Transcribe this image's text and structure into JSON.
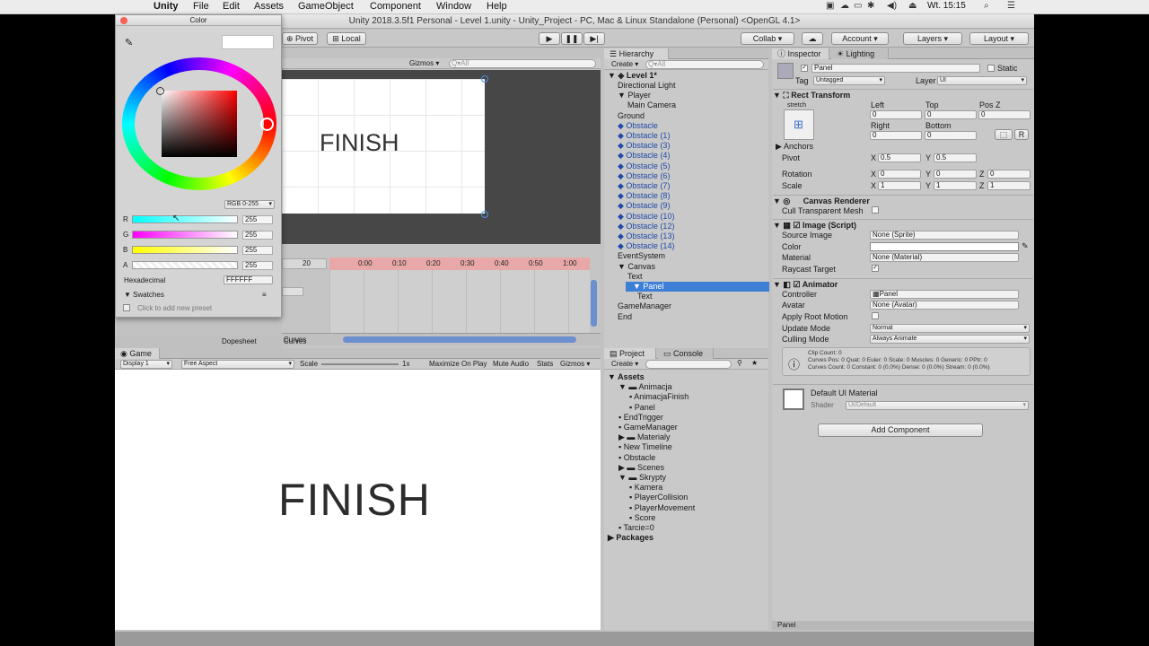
{
  "menubar": {
    "app": "Unity",
    "items": [
      "File",
      "Edit",
      "Assets",
      "GameObject",
      "Component",
      "Window",
      "Help"
    ],
    "clock": "Wt. 15:15"
  },
  "window": {
    "title": "Unity 2018.3.5f1 Personal - Level 1.unity - Unity_Project - PC, Mac & Linux Standalone (Personal) <OpenGL 4.1>"
  },
  "toolbar": {
    "pivot": "Pivot",
    "local": "Local",
    "collab": "Collab ▾",
    "account": "Account",
    "layers": "Layers",
    "layout": "Layout"
  },
  "scene": {
    "gizmos": "Gizmos",
    "search": "Q▾All",
    "text": "FINISH"
  },
  "animation": {
    "frame": "20",
    "ticks": [
      "0:00",
      "0:10",
      "0:20",
      "0:30",
      "0:40",
      "0:50",
      "1:00"
    ],
    "tab_dopesheet": "Dopesheet",
    "tab_curves": "Curves"
  },
  "game": {
    "tab": "Game",
    "display": "Display 1",
    "aspect": "Free Aspect",
    "scale_label": "Scale",
    "scale_value": "1x",
    "maximize": "Maximize On Play",
    "mute": "Mute Audio",
    "stats": "Stats",
    "gizmos": "Gizmos",
    "text": "FINISH"
  },
  "hierarchy": {
    "tab": "Hierarchy",
    "create": "Create",
    "search": "Q▾All",
    "scene": "Level 1*",
    "items": [
      {
        "label": "Directional Light",
        "indent": 1,
        "arrow": "",
        "blue": false
      },
      {
        "label": "Player",
        "indent": 1,
        "arrow": "▼",
        "blue": false
      },
      {
        "label": "Main Camera",
        "indent": 2,
        "arrow": "",
        "blue": false
      },
      {
        "label": "Ground",
        "indent": 1,
        "arrow": "",
        "blue": false
      },
      {
        "label": "Obstacle",
        "indent": 1,
        "arrow": "",
        "blue": true
      },
      {
        "label": "Obstacle (1)",
        "indent": 1,
        "arrow": "",
        "blue": true
      },
      {
        "label": "Obstacle (3)",
        "indent": 1,
        "arrow": "",
        "blue": true
      },
      {
        "label": "Obstacle (4)",
        "indent": 1,
        "arrow": "",
        "blue": true
      },
      {
        "label": "Obstacle (5)",
        "indent": 1,
        "arrow": "",
        "blue": true
      },
      {
        "label": "Obstacle (6)",
        "indent": 1,
        "arrow": "",
        "blue": true
      },
      {
        "label": "Obstacle (7)",
        "indent": 1,
        "arrow": "",
        "blue": true
      },
      {
        "label": "Obstacle (8)",
        "indent": 1,
        "arrow": "",
        "blue": true
      },
      {
        "label": "Obstacle (9)",
        "indent": 1,
        "arrow": "",
        "blue": true
      },
      {
        "label": "Obstacle (10)",
        "indent": 1,
        "arrow": "",
        "blue": true
      },
      {
        "label": "Obstacle (12)",
        "indent": 1,
        "arrow": "",
        "blue": true
      },
      {
        "label": "Obstacle (13)",
        "indent": 1,
        "arrow": "",
        "blue": true
      },
      {
        "label": "Obstacle (14)",
        "indent": 1,
        "arrow": "",
        "blue": true
      },
      {
        "label": "EventSystem",
        "indent": 1,
        "arrow": "",
        "blue": false
      },
      {
        "label": "Canvas",
        "indent": 1,
        "arrow": "▼",
        "blue": false
      },
      {
        "label": "Text",
        "indent": 2,
        "arrow": "",
        "blue": false
      },
      {
        "label": "Panel",
        "indent": 2,
        "arrow": "▼",
        "blue": false,
        "selected": true
      },
      {
        "label": "Text",
        "indent": 3,
        "arrow": "",
        "blue": false
      },
      {
        "label": "GameManager",
        "indent": 1,
        "arrow": "",
        "blue": false
      },
      {
        "label": "End",
        "indent": 1,
        "arrow": "",
        "blue": false
      }
    ]
  },
  "project": {
    "tab": "Project",
    "console_tab": "Console",
    "create": "Create",
    "items": [
      {
        "label": "Assets",
        "indent": 0,
        "arrow": "▼",
        "bold": true
      },
      {
        "label": "Animacja",
        "indent": 1,
        "arrow": "▼"
      },
      {
        "label": "AnimacjaFinish",
        "indent": 2,
        "arrow": ""
      },
      {
        "label": "Panel",
        "indent": 2,
        "arrow": ""
      },
      {
        "label": "EndTrigger",
        "indent": 1,
        "arrow": ""
      },
      {
        "label": "GameManager",
        "indent": 1,
        "arrow": ""
      },
      {
        "label": "Materialy",
        "indent": 1,
        "arrow": "▶"
      },
      {
        "label": "New Timeline",
        "indent": 1,
        "arrow": ""
      },
      {
        "label": "Obstacle",
        "indent": 1,
        "arrow": ""
      },
      {
        "label": "Scenes",
        "indent": 1,
        "arrow": "▶"
      },
      {
        "label": "Skrypty",
        "indent": 1,
        "arrow": "▼"
      },
      {
        "label": "Kamera",
        "indent": 2,
        "arrow": ""
      },
      {
        "label": "PlayerCollision",
        "indent": 2,
        "arrow": ""
      },
      {
        "label": "PlayerMovement",
        "indent": 2,
        "arrow": ""
      },
      {
        "label": "Score",
        "indent": 2,
        "arrow": ""
      },
      {
        "label": "Tarcie=0",
        "indent": 1,
        "arrow": ""
      },
      {
        "label": "Packages",
        "indent": 0,
        "arrow": "▶",
        "bold": true
      }
    ]
  },
  "inspector": {
    "tab": "Inspector",
    "lighting_tab": "Lighting",
    "name": "Panel",
    "static": "Static",
    "tag_label": "Tag",
    "tag": "Untagged",
    "layer_label": "Layer",
    "layer": "UI",
    "rect_transform": "Rect Transform",
    "stretch": "stretch",
    "left_label": "Left",
    "top_label": "Top",
    "posz_label": "Pos Z",
    "left": "0",
    "top": "0",
    "posz": "0",
    "right_label": "Right",
    "bottom_label": "Bottom",
    "right": "0",
    "bottom": "0",
    "r_btn": "R",
    "anchors": "Anchors",
    "pivot_label": "Pivot",
    "pivot_x": "0.5",
    "pivot_y": "0.5",
    "rotation_label": "Rotation",
    "rot_x": "0",
    "rot_y": "0",
    "rot_z": "0",
    "scale_label": "Scale",
    "scale_x": "1",
    "scale_y": "1",
    "scale_z": "1",
    "canvas_renderer": "Canvas Renderer",
    "cull": "Cull Transparent Mesh",
    "image_script": "Image (Script)",
    "source_image_label": "Source Image",
    "source_image": "None (Sprite)",
    "color_label": "Color",
    "material_label": "Material",
    "material": "None (Material)",
    "raycast_label": "Raycast Target",
    "animator": "Animator",
    "controller_label": "Controller",
    "controller": "Panel",
    "avatar_label": "Avatar",
    "avatar": "None (Avatar)",
    "apply_root_label": "Apply Root Motion",
    "update_mode_label": "Update Mode",
    "update_mode": "Normal",
    "culling_mode_label": "Culling Mode",
    "culling_mode": "Always Animate",
    "clip_info_1": "Clip Count: 0",
    "clip_info_2": "Curves Pos: 0 Quat: 0 Euler: 0 Scale: 0 Muscles: 0 Generic: 0 PPtr: 0",
    "clip_info_3": "Curves Count: 0 Constant: 0 (0.0%) Dense: 0 (0.0%) Stream: 0 (0.0%)",
    "default_material": "Default UI Material",
    "shader_label": "Shader",
    "shader": "UI/Default",
    "add_component": "Add Component",
    "footer": "Panel"
  },
  "colorpicker": {
    "title": "Color",
    "mode": "RGB 0-255",
    "channels": [
      {
        "name": "R",
        "value": "255"
      },
      {
        "name": "G",
        "value": "255"
      },
      {
        "name": "B",
        "value": "255"
      },
      {
        "name": "A",
        "value": "255"
      }
    ],
    "hex_label": "Hexadecimal",
    "hex": "FFFFFF",
    "swatches": "Swatches",
    "add_preset": "Click to add new preset"
  }
}
